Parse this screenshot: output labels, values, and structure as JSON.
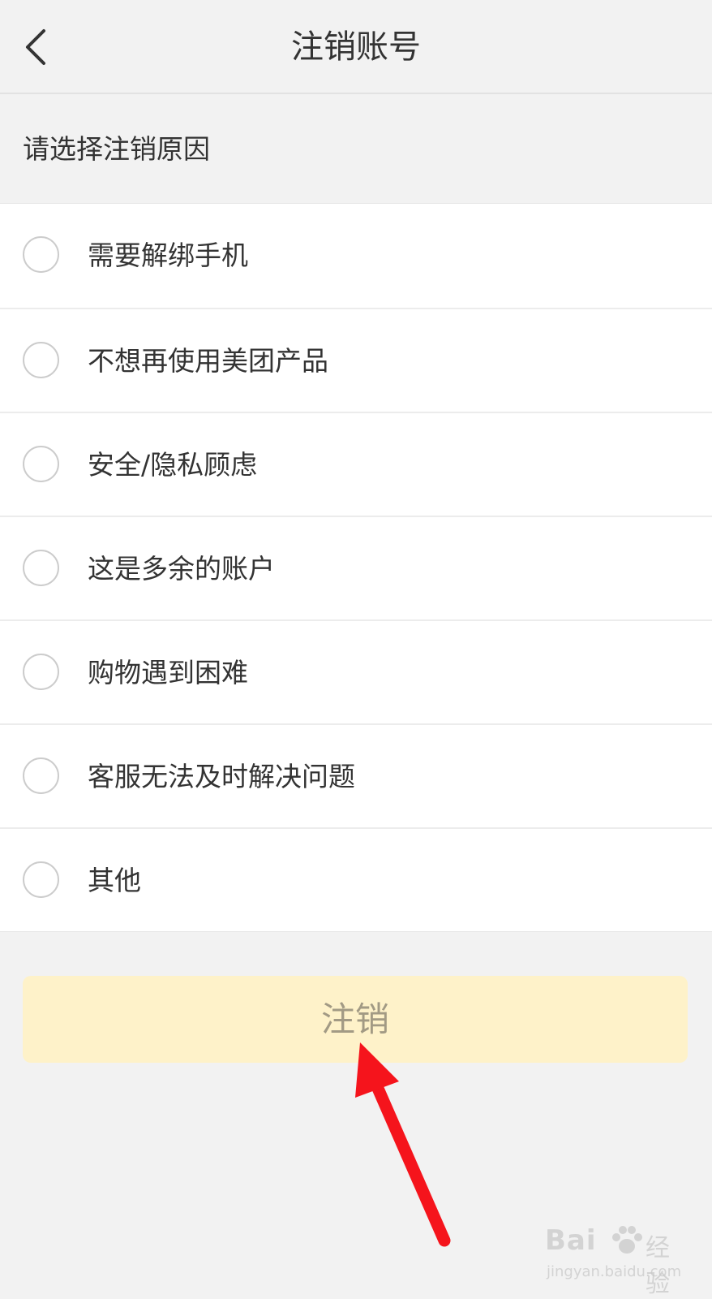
{
  "header": {
    "title": "注销账号",
    "back_icon": "chevron-left-icon"
  },
  "reason_section": {
    "label": "请选择注销原因",
    "options": [
      {
        "label": "需要解绑手机",
        "selected": false
      },
      {
        "label": "不想再使用美团产品",
        "selected": false
      },
      {
        "label": "安全/隐私顾虑",
        "selected": false
      },
      {
        "label": "这是多余的账户",
        "selected": false
      },
      {
        "label": "购物遇到困难",
        "selected": false
      },
      {
        "label": "客服无法及时解决问题",
        "selected": false
      },
      {
        "label": "其他",
        "selected": false
      }
    ]
  },
  "submit": {
    "label": "注销",
    "enabled": false
  },
  "watermark": {
    "brand_prefix": "Bai",
    "brand_suffix": "经验",
    "url": "jingyan.baidu.com"
  },
  "colors": {
    "page_background": "#f2f2f2",
    "button_background": "#fef2c9",
    "button_text": "#a29a84",
    "annotation_arrow": "#f5141c"
  }
}
